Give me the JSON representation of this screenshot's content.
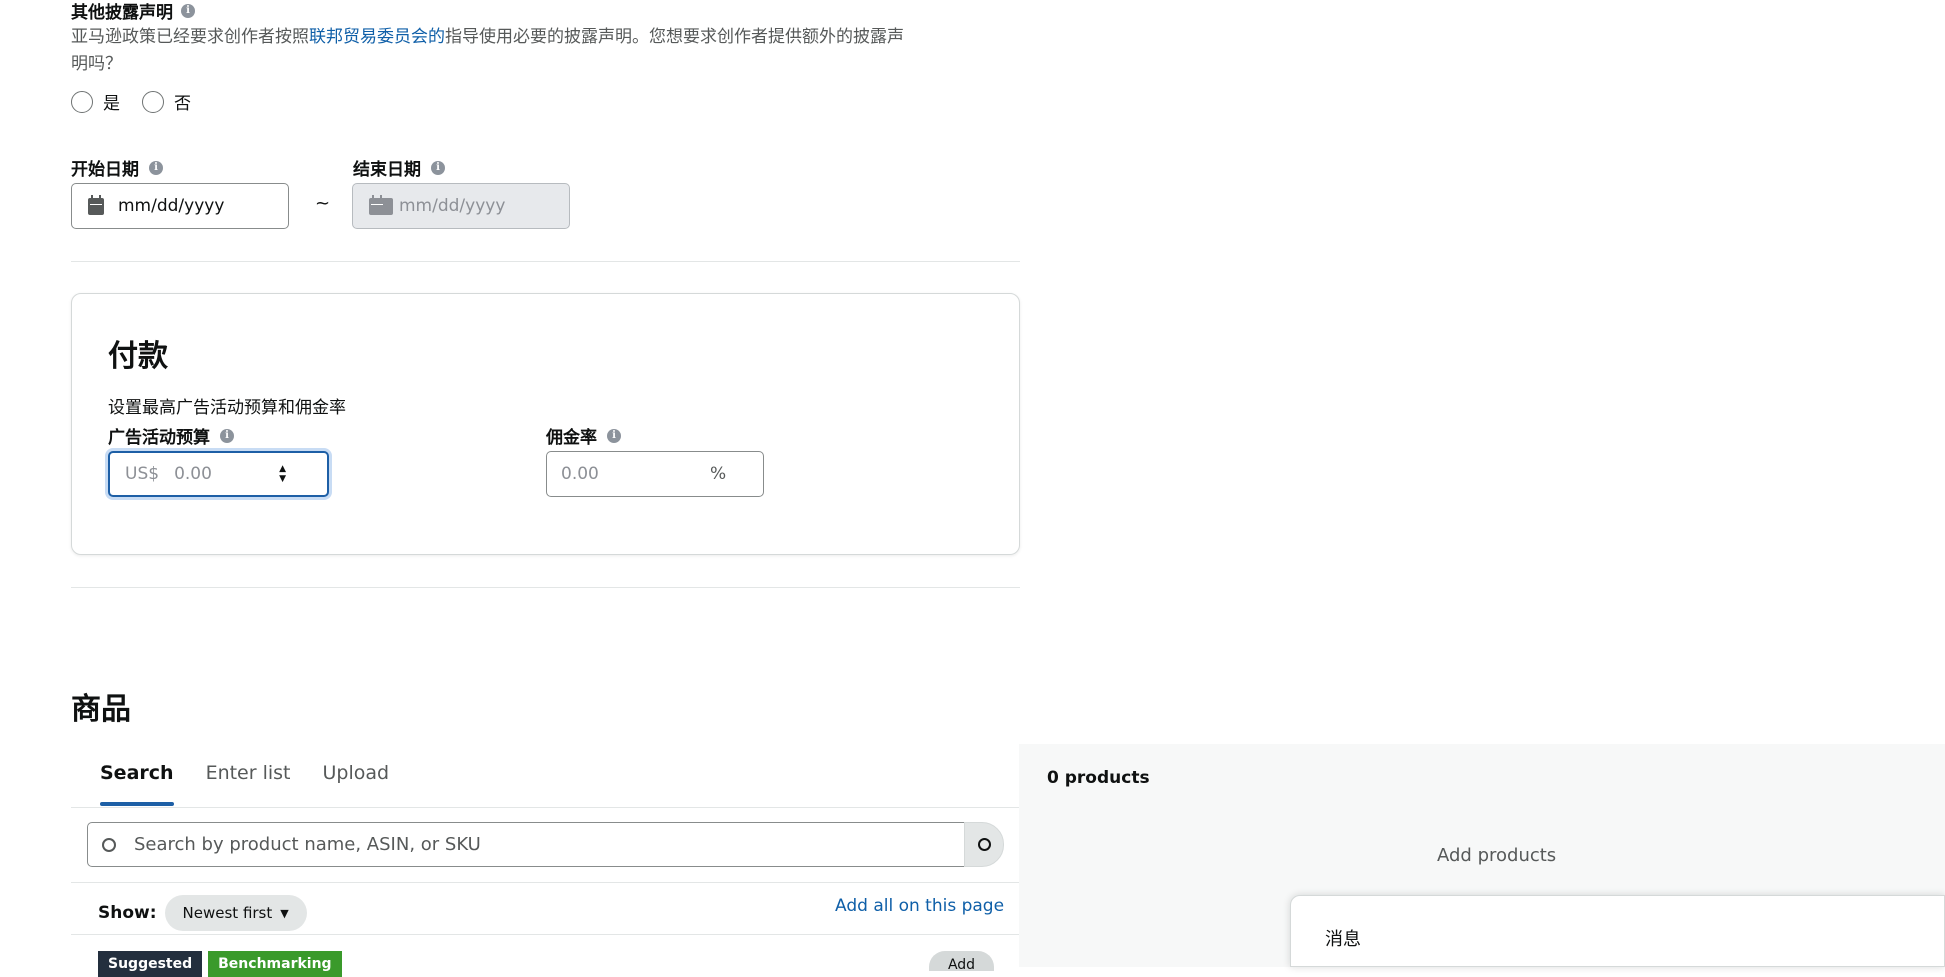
{
  "disclosure": {
    "title": "其他披露声明",
    "text_prefix": "亚马逊政策已经要求创作者按照",
    "text_link": "联邦贸易委员会的",
    "text_suffix_line1": "指导使用必要的披露声明。您想要求创作者提供额外的披露声",
    "text_line2": "明吗？",
    "options": [
      {
        "label": "是"
      },
      {
        "label": "否"
      }
    ]
  },
  "dates": {
    "start_label": "开始日期",
    "end_label": "结束日期",
    "start_placeholder": "mm/dd/yyyy",
    "end_placeholder": "mm/dd/yyyy",
    "separator": "~"
  },
  "payment": {
    "title": "付款",
    "subtitle": "设置最高广告活动预算和佣金率",
    "budget_label": "广告活动预算",
    "budget_prefix": "US$",
    "budget_value": "0.00",
    "commission_label": "佣金率",
    "commission_value": "0.00",
    "commission_suffix": "%"
  },
  "products": {
    "title": "商品",
    "tabs": [
      {
        "label": "Search"
      },
      {
        "label": "Enter list"
      },
      {
        "label": "Upload"
      }
    ],
    "search_placeholder": "Search by product name, ASIN, or SKU",
    "show_label": "Show:",
    "sort_value": "Newest first",
    "add_all_link": "Add all on this page",
    "badge_suggested": "Suggested",
    "badge_benchmarking": "Benchmarking",
    "add_button": "Add",
    "count_label": "0 products",
    "empty_label": "Add products",
    "message_title": "消息"
  },
  "colors": {
    "accent": "#1d5fa6",
    "link": "#0f5fa8",
    "badge_suggested": "#232f3e",
    "badge_benchmarking": "#3a9a2b"
  }
}
